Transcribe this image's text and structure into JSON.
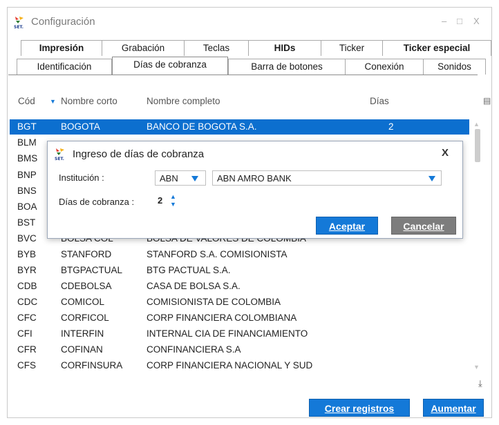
{
  "window": {
    "title": "Configuración",
    "controls": {
      "minimize": "–",
      "maximize": "□",
      "close": "X"
    }
  },
  "tabs": {
    "row1": [
      {
        "label": "Impresión"
      },
      {
        "label": "Grabación"
      },
      {
        "label": "Teclas"
      },
      {
        "label": "HIDs"
      },
      {
        "label": "Ticker"
      },
      {
        "label": "Ticker especial"
      }
    ],
    "row2": [
      {
        "label": "Identificación"
      },
      {
        "label": "Días de cobranza",
        "active": true
      },
      {
        "label": "Barra de botones"
      },
      {
        "label": "Conexión"
      },
      {
        "label": "Sonidos"
      }
    ]
  },
  "grid": {
    "columns": {
      "cod": "Cód",
      "nombre_corto": "Nombre corto",
      "nombre_completo": "Nombre completo",
      "dias": "Días"
    },
    "rows": [
      {
        "cod": "BGT",
        "corto": "BOGOTA",
        "completo": "BANCO DE BOGOTA S.A.",
        "dias": "2"
      },
      {
        "cod": "BLM",
        "corto": "",
        "completo": "",
        "dias": ""
      },
      {
        "cod": "BMS",
        "corto": "",
        "completo": "",
        "dias": ""
      },
      {
        "cod": "BNP",
        "corto": "",
        "completo": "",
        "dias": ""
      },
      {
        "cod": "BNS",
        "corto": "",
        "completo": "",
        "dias": ""
      },
      {
        "cod": "BOA",
        "corto": "",
        "completo": "",
        "dias": ""
      },
      {
        "cod": "BST",
        "corto": "",
        "completo": "",
        "dias": ""
      },
      {
        "cod": "BVC",
        "corto": "BOLSA COL",
        "completo": "BOLSA DE VALORES DE COLOMBIA",
        "dias": ""
      },
      {
        "cod": "BYB",
        "corto": "STANFORD",
        "completo": "STANFORD S.A. COMISIONISTA",
        "dias": ""
      },
      {
        "cod": "BYR",
        "corto": "BTGPACTUAL",
        "completo": "BTG PACTUAL S.A.",
        "dias": ""
      },
      {
        "cod": "CDB",
        "corto": "CDEBOLSA",
        "completo": "CASA DE BOLSA S.A.",
        "dias": ""
      },
      {
        "cod": "CDC",
        "corto": "COMICOL",
        "completo": "COMISIONISTA DE COLOMBIA",
        "dias": ""
      },
      {
        "cod": "CFC",
        "corto": "CORFICOL",
        "completo": "CORP FINANCIERA COLOMBIANA",
        "dias": ""
      },
      {
        "cod": "CFI",
        "corto": "INTERFIN",
        "completo": "INTERNAL CIA DE FINANCIAMIENTO",
        "dias": ""
      },
      {
        "cod": "CFR",
        "corto": "COFINAN",
        "completo": "CONFINANCIERA S.A",
        "dias": ""
      },
      {
        "cod": "CFS",
        "corto": "CORFINSURA",
        "completo": "CORP FINANCIERA NACIONAL Y SUD",
        "dias": ""
      }
    ]
  },
  "buttons": {
    "crear": "Crear registros",
    "aumentar": "Aumentar"
  },
  "dialog": {
    "title": "Ingreso de días de cobranza",
    "close": "X",
    "institucion_label": "Institución :",
    "institucion_code": "ABN",
    "institucion_name": "ABN AMRO BANK",
    "dias_label": "Días de cobranza :",
    "dias_value": "2",
    "aceptar": "Aceptar",
    "cancelar": "Cancelar"
  },
  "colors": {
    "accent": "#1479d8",
    "selected_row": "#0c6fcf",
    "cancel": "#7d7d7d"
  }
}
